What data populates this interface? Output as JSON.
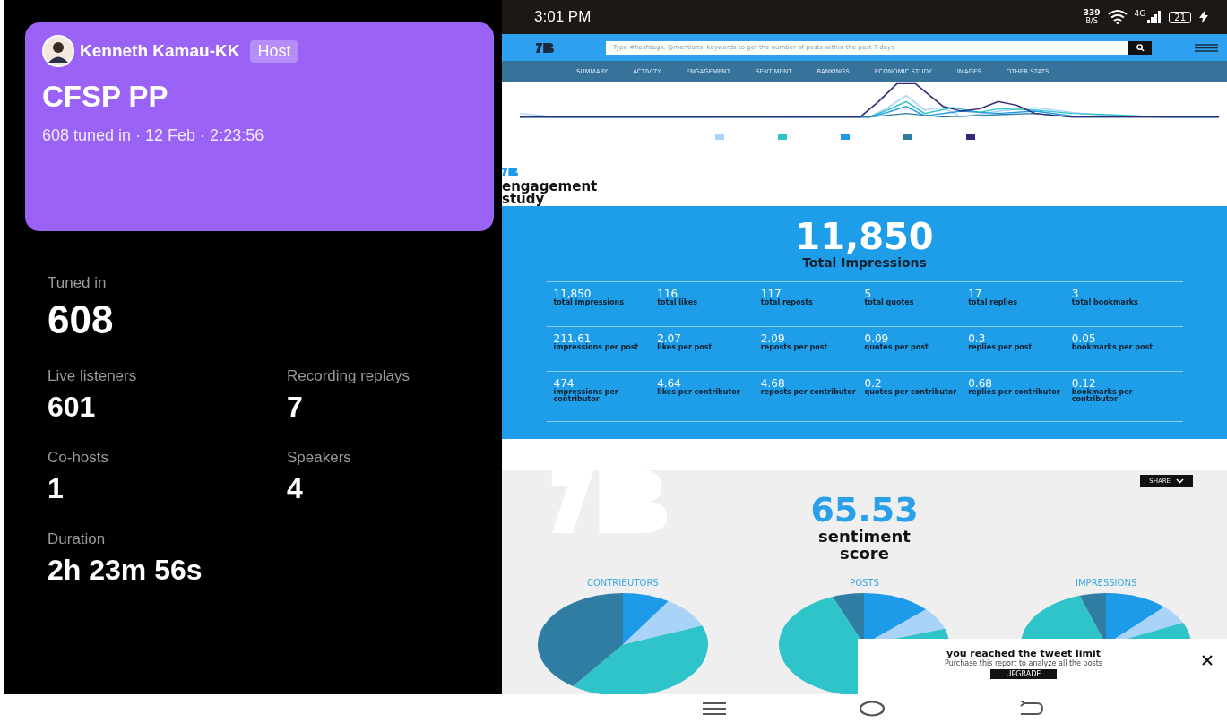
{
  "space_card": {
    "host": "Kenneth Kamau-KK",
    "role_badge": "Host",
    "title": "CFSP PP",
    "subtitle": "608 tuned in · 12 Feb · 2:23:56"
  },
  "stats": [
    {
      "label": "Tuned in",
      "value": "608",
      "kind": "wide"
    },
    {
      "label": "Live listeners",
      "value": "601",
      "kind": "half"
    },
    {
      "label": "Recording replays",
      "value": "7",
      "kind": "half"
    },
    {
      "label": "Co-hosts",
      "value": "1",
      "kind": "half"
    },
    {
      "label": "Speakers",
      "value": "4",
      "kind": "half"
    },
    {
      "label": "Duration",
      "value": "2h 23m 56s",
      "kind": "wide"
    }
  ],
  "status_bar": {
    "time": "3:01 PM",
    "net_speed": "339",
    "net_unit": "B/S",
    "network": "4G",
    "battery": "21"
  },
  "search": {
    "placeholder": "Type #hashtags, @mentions, keywords to get the number of posts within the past 7 days"
  },
  "nav": [
    "SUMMARY",
    "ACTIVITY",
    "ENGAGEMENT",
    "SENTIMENT",
    "RANKINGS",
    "ECONOMIC STUDY",
    "IMAGES",
    "OTHER STATS"
  ],
  "engagement": {
    "heading": "engagement study",
    "total": "11,850",
    "total_label": "Total Impressions",
    "rows": [
      [
        {
          "value": "11,850",
          "label": "total impressions"
        },
        {
          "value": "116",
          "label": "total likes"
        },
        {
          "value": "117",
          "label": "total reposts"
        },
        {
          "value": "5",
          "label": "total quotes"
        },
        {
          "value": "17",
          "label": "total replies"
        },
        {
          "value": "3",
          "label": "total bookmarks"
        }
      ],
      [
        {
          "value": "211.61",
          "label": "impressions per post"
        },
        {
          "value": "2.07",
          "label": "likes per post"
        },
        {
          "value": "2.09",
          "label": "reposts per post"
        },
        {
          "value": "0.09",
          "label": "quotes per post"
        },
        {
          "value": "0.3",
          "label": "replies per post"
        },
        {
          "value": "0.05",
          "label": "bookmarks per post"
        }
      ],
      [
        {
          "value": "474",
          "label": "impressions per contributor"
        },
        {
          "value": "4.64",
          "label": "likes per contributor"
        },
        {
          "value": "4.68",
          "label": "reposts per contributor"
        },
        {
          "value": "0.2",
          "label": "quotes per contributor"
        },
        {
          "value": "0.68",
          "label": "replies per contributor"
        },
        {
          "value": "0.12",
          "label": "bookmarks per contributor"
        }
      ]
    ]
  },
  "sentiment": {
    "share": "SHARE",
    "score": "65.53",
    "label": "sentiment score",
    "pies": [
      {
        "title": "CONTRIBUTORS"
      },
      {
        "title": "POSTS"
      },
      {
        "title": "IMPRESSIONS"
      }
    ]
  },
  "popup": {
    "title": "you reached the tweet limit",
    "text": "Purchase this report to analyze all the posts",
    "button": "UPGRADE"
  }
}
